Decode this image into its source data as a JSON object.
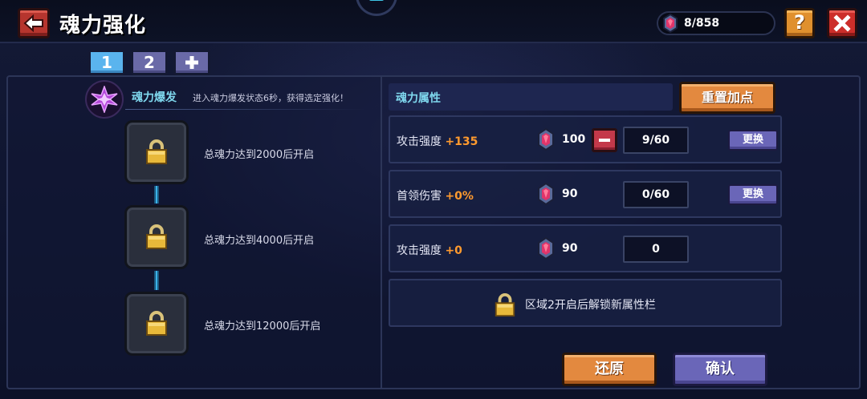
{
  "header": {
    "title": "魂力强化",
    "currency": "8/858",
    "help_label": "?"
  },
  "tabs": [
    {
      "label": "1",
      "active": true
    },
    {
      "label": "2",
      "active": false
    },
    {
      "label": "+",
      "active": false
    }
  ],
  "burst": {
    "label": "魂力爆发",
    "description": "进入魂力爆发状态6秒，获得选定强化！"
  },
  "lock_nodes": [
    {
      "text": "总魂力达到2000后开启"
    },
    {
      "text": "总魂力达到4000后开启"
    },
    {
      "text": "总魂力达到12000后开启"
    }
  ],
  "attributes": {
    "title": "魂力属性",
    "reset_label": "重置加点",
    "rows": [
      {
        "name": "攻击强度",
        "bonus": "+135",
        "cost": "100",
        "points": "9/60",
        "swap_label": "更换"
      },
      {
        "name": "首领伤害",
        "bonus": "+0%",
        "cost": "90",
        "points": "0/60",
        "swap_label": "更换"
      },
      {
        "name": "攻击强度",
        "bonus": "+0",
        "cost": "90",
        "points": "0"
      }
    ],
    "unlock_text": "区域2开启后解锁新属性栏"
  },
  "footer": {
    "restore_label": "还原",
    "confirm_label": "确认"
  },
  "colors": {
    "accent_cyan": "#7fd8ee",
    "bonus_orange": "#ff9a2e",
    "button_orange": "#e3893f",
    "button_purple": "#6a66b8",
    "button_red": "#cc2e2a"
  },
  "icons": [
    "back-arrow-icon",
    "soul-gem-icon",
    "question-icon",
    "close-icon",
    "soul-burst-icon",
    "lock-icon",
    "minus-icon",
    "plus-icon"
  ]
}
